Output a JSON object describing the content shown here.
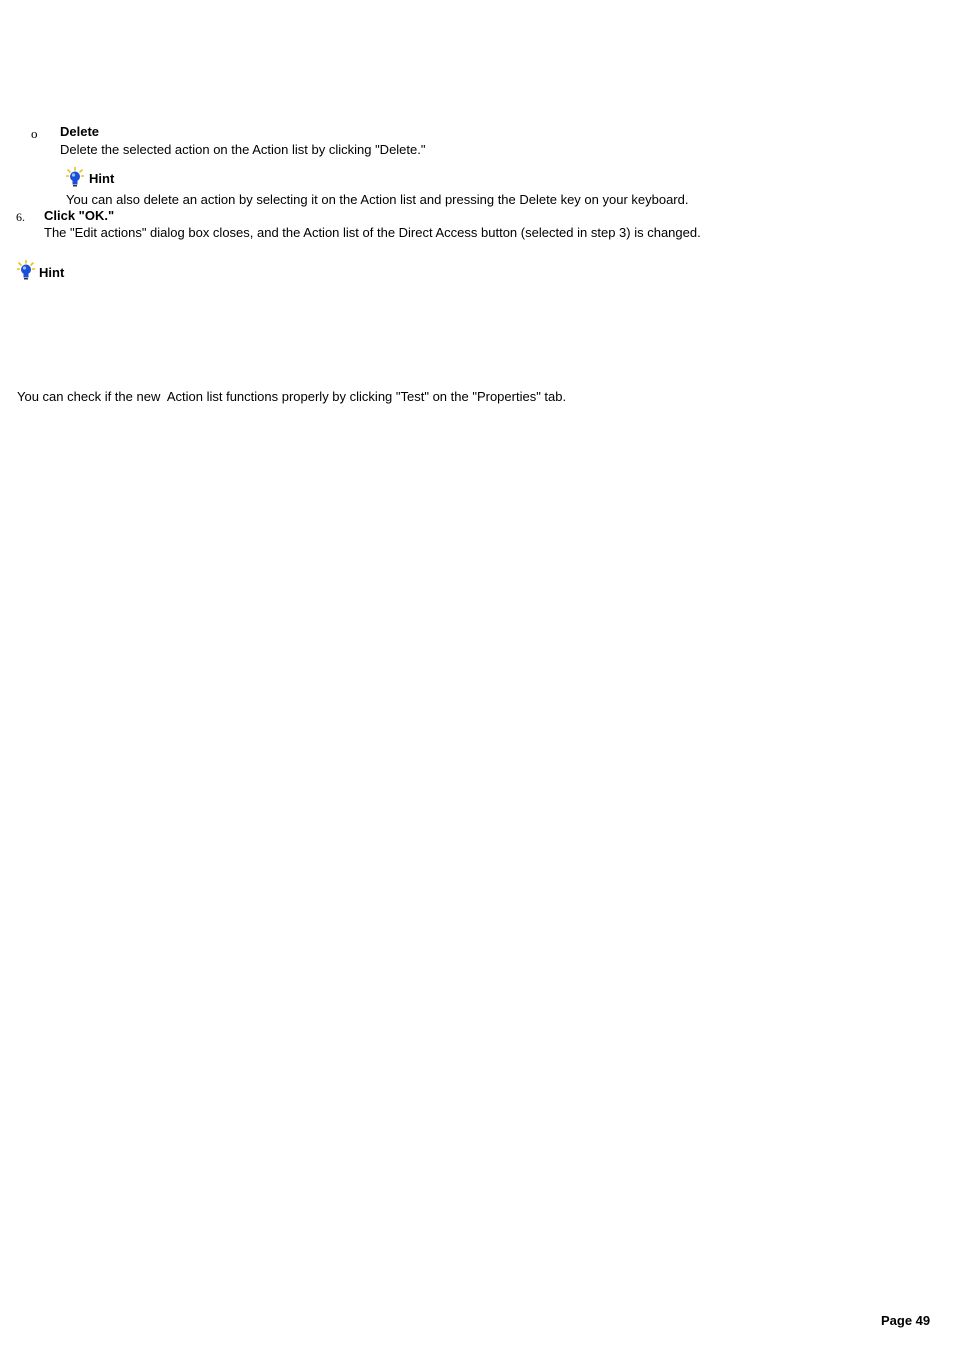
{
  "delete_item": {
    "bullet": "o",
    "title": "Delete",
    "description": "Delete the selected action on the Action list by clicking \"Delete.\"",
    "hint": {
      "label": "Hint",
      "text": "You can also delete an action by selecting it on the Action list and pressing the Delete key on your keyboard."
    }
  },
  "step6": {
    "number": "6.",
    "title": "Click \"OK.\"",
    "description": "The \"Edit actions\" dialog box closes, and the Action list of the Direct Access button (selected in step 3) is changed."
  },
  "page_hint": {
    "label": "Hint",
    "text": "You can check if the new  Action list functions properly by clicking \"Test\" on the \"Properties\" tab."
  },
  "footer": {
    "page_label": "Page 49"
  },
  "icons": {
    "hint_icon": "lightbulb-icon",
    "bulb_color": "#1a4fd6",
    "glow_color": "#e8c21a"
  }
}
